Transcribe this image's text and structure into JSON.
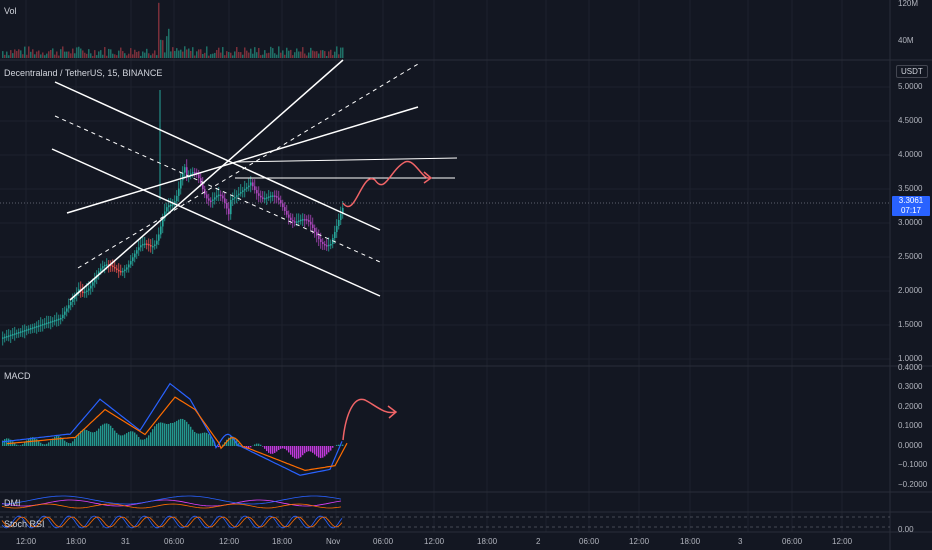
{
  "volume_pane": {
    "title": "Vol",
    "ticks": [
      "120M",
      "40M"
    ]
  },
  "main_pane": {
    "symbol_label": "Decentraland / TetherUS, 15, BINANCE",
    "currency_button": "USDT",
    "price_ticks": [
      "5.0000",
      "4.5000",
      "4.0000",
      "3.5000",
      "3.0000",
      "2.5000",
      "2.0000",
      "1.5000",
      "1.0000"
    ],
    "current_price": "3.3061",
    "countdown": "07:17"
  },
  "macd_pane": {
    "title": "MACD",
    "ticks": [
      "0.4000",
      "0.3000",
      "0.2000",
      "0.1000",
      "0.0000",
      "−0.1000",
      "−0.2000"
    ]
  },
  "dmi_pane": {
    "title": "DMI"
  },
  "stoch_pane": {
    "title": "Stoch RSI",
    "ticks": [
      "0.00"
    ]
  },
  "time_axis": {
    "ticks": [
      "12:00",
      "18:00",
      "31",
      "06:00",
      "12:00",
      "18:00",
      "Nov",
      "06:00",
      "12:00",
      "18:00",
      "2",
      "06:00",
      "12:00",
      "18:00",
      "3",
      "06:00",
      "12:00"
    ]
  },
  "colors": {
    "background": "#131722",
    "up_candle": "#26a69a",
    "down_candle": "#ef5350",
    "macd_line": "#2962ff",
    "signal_line": "#ff6d00",
    "drawing_arrow": "#f06467",
    "trendline": "#ffffff",
    "current_price": "#2962ff"
  }
}
